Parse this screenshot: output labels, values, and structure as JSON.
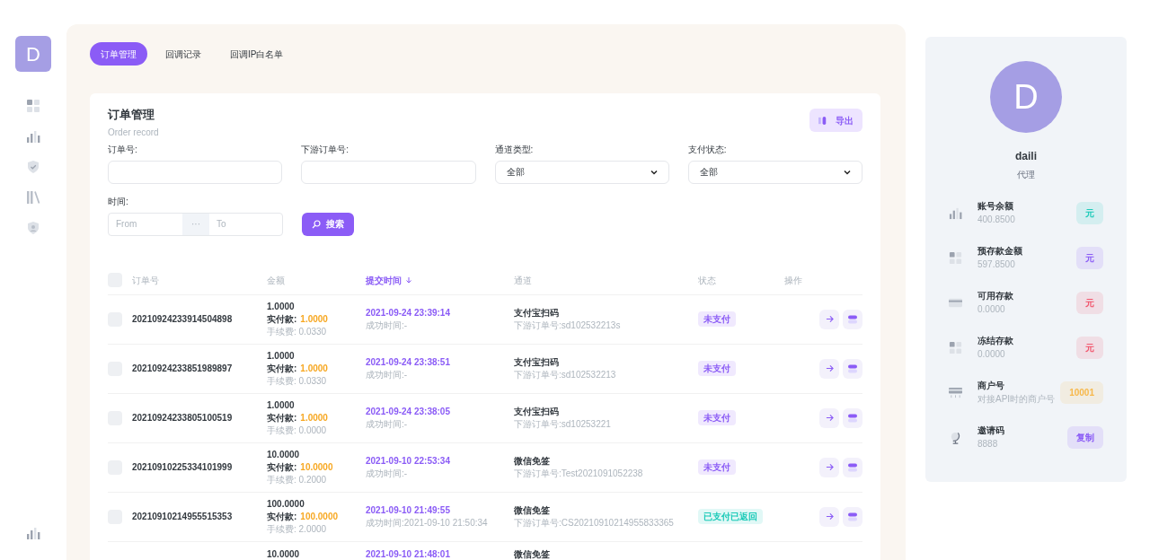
{
  "sidebar": {
    "avatar_letter": "D",
    "items": [
      {
        "kind": "grid",
        "selected": false
      },
      {
        "kind": "chart",
        "selected": false
      },
      {
        "kind": "shield",
        "selected": false
      },
      {
        "kind": "library",
        "selected": false
      },
      {
        "kind": "user-shield",
        "selected": false
      }
    ],
    "bottom_item": {
      "kind": "chart"
    }
  },
  "tabs": [
    {
      "label": "订单管理",
      "selected": true
    },
    {
      "label": "回调记录",
      "selected": false
    },
    {
      "label": "回调IP白名单",
      "selected": false
    }
  ],
  "card": {
    "title": "订单管理",
    "subtitle": "Order record",
    "export_button": "导出",
    "filters": [
      {
        "kind": "input",
        "label": "订单号:"
      },
      {
        "kind": "input",
        "label": "下游订单号:"
      },
      {
        "kind": "select",
        "label": "通道类型:",
        "value": "全部"
      },
      {
        "kind": "select",
        "label": "支付状态:",
        "value": "全部"
      }
    ],
    "time_filter": {
      "label": "时间:",
      "from_placeholder": "From",
      "separator": "···",
      "to_placeholder": "To"
    },
    "search_button": "搜索"
  },
  "table": {
    "select_all_checked": false,
    "columns": [
      {
        "label": "订单号",
        "sorted": false
      },
      {
        "label": "金额",
        "sorted": false
      },
      {
        "label": "提交时间",
        "sorted": true
      },
      {
        "label": "通道",
        "sorted": false
      },
      {
        "label": "状态",
        "sorted": false
      },
      {
        "label": "操作",
        "sorted": false
      }
    ],
    "rows": [
      {
        "order_no": "20210924233914504898",
        "amount": "1.0000",
        "paid_label": "实付款:",
        "paid": "1.0000",
        "fee": "手续费: 0.0330",
        "submit_time": "2021-09-24 23:39:14",
        "success_time": "成功时间:-",
        "channel": "支付宝扫码",
        "downstream": "下游订单号:sd102532213s",
        "status": "未支付",
        "color": "#8b5cf6",
        "checked": false
      },
      {
        "order_no": "20210924233851989897",
        "amount": "1.0000",
        "paid_label": "实付款:",
        "paid": "1.0000",
        "fee": "手续费: 0.0330",
        "submit_time": "2021-09-24 23:38:51",
        "success_time": "成功时间:-",
        "channel": "支付宝扫码",
        "downstream": "下游订单号:sd102532213",
        "status": "未支付",
        "color": "#8b5cf6",
        "checked": false
      },
      {
        "order_no": "20210924233805100519",
        "amount": "1.0000",
        "paid_label": "实付款:",
        "paid": "1.0000",
        "fee": "手续费: 0.0000",
        "submit_time": "2021-09-24 23:38:05",
        "success_time": "成功时间:-",
        "channel": "支付宝扫码",
        "downstream": "下游订单号:sd10253221",
        "status": "未支付",
        "color": "#8b5cf6",
        "checked": false
      },
      {
        "order_no": "20210910225334101999",
        "amount": "10.0000",
        "paid_label": "实付款:",
        "paid": "10.0000",
        "fee": "手续费: 0.2000",
        "submit_time": "2021-09-10 22:53:34",
        "success_time": "成功时间:-",
        "channel": "微信免签",
        "downstream": "下游订单号:Test2021091052238",
        "status": "未支付",
        "color": "#8b5cf6",
        "checked": false
      },
      {
        "order_no": "20210910214955515353",
        "amount": "100.0000",
        "paid_label": "实付款:",
        "paid": "100.0000",
        "fee": "手续费: 2.0000",
        "submit_time": "2021-09-10 21:49:55",
        "success_time": "成功时间:2021-09-10 21:50:34",
        "channel": "微信免签",
        "downstream": "下游订单号:CS20210910214955833365",
        "status": "已支付已返回",
        "color": "#1ccab8",
        "checked": false
      }
    ],
    "partial_row": {
      "amount": "10.0000",
      "submit_time": "2021-09-10 21:48:01",
      "channel": "微信免签"
    }
  },
  "profile": {
    "avatar_letter": "D",
    "name": "daili",
    "role": "代理",
    "stats": [
      {
        "kind": "chart",
        "label": "账号余额",
        "value": "400.8500",
        "badge": "元",
        "color": "#1ccab8"
      },
      {
        "kind": "grid",
        "label": "预存款金额",
        "value": "597.8500",
        "badge": "元",
        "color": "#8b5cf6"
      },
      {
        "kind": "card",
        "label": "可用存款",
        "value": "0.0000",
        "badge": "元",
        "color": "#f1556c"
      },
      {
        "kind": "grid",
        "label": "冻结存款",
        "value": "0.0000",
        "badge": "元",
        "color": "#f1556c"
      },
      {
        "kind": "terminal",
        "label": "商户号",
        "value": "对接API时的商户号",
        "badge": "10001",
        "color": "#f7b84b"
      },
      {
        "kind": "globe",
        "label": "邀请码",
        "value": "8888",
        "badge": "复制",
        "color": "#8b5cf6"
      }
    ]
  }
}
